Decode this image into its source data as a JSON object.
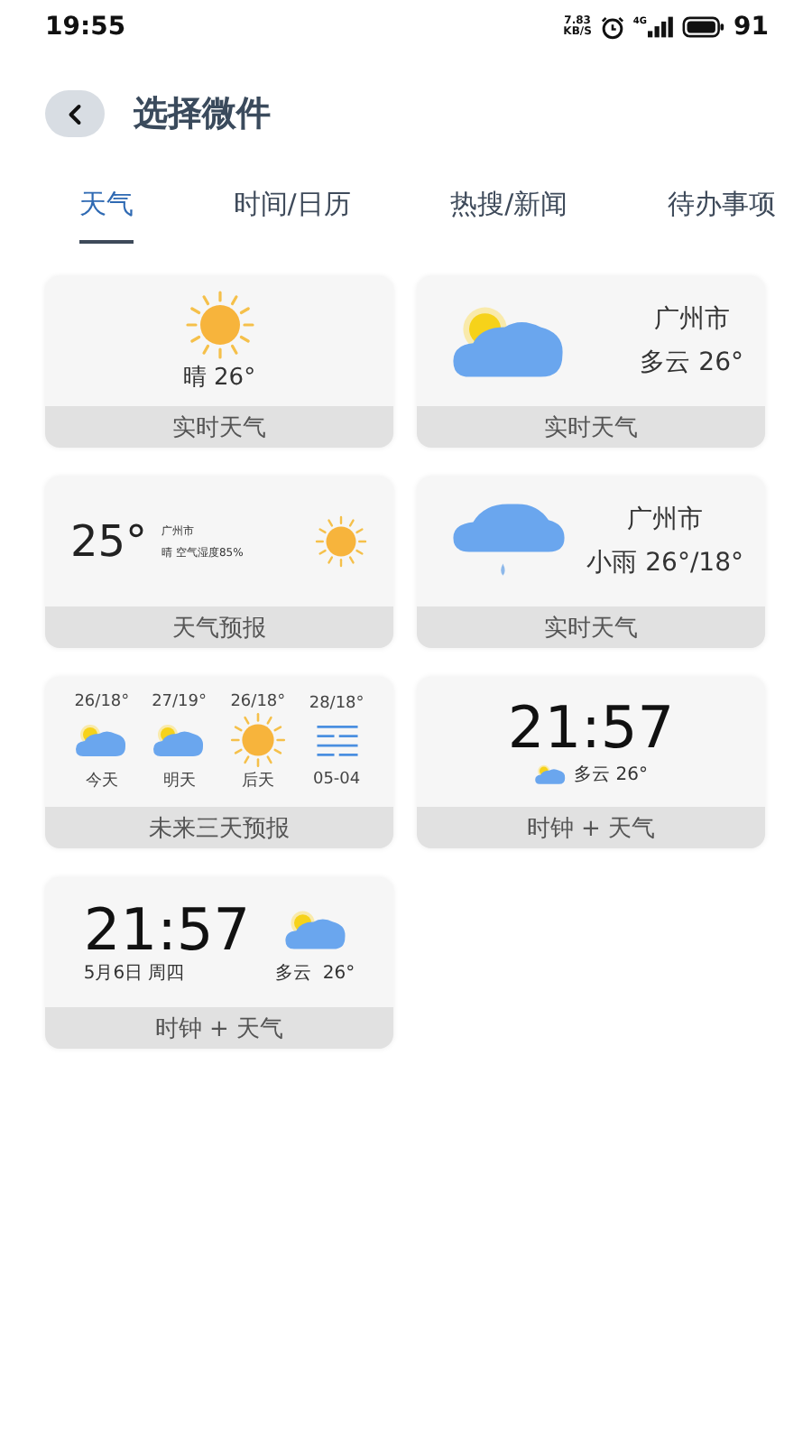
{
  "status_bar": {
    "time": "19:55",
    "speed_value": "7.83",
    "speed_unit": "KB/S",
    "network": "4G",
    "battery": "91"
  },
  "header": {
    "title": "选择微件"
  },
  "tabs": [
    {
      "label": "天气",
      "selected": true
    },
    {
      "label": "时间/日历",
      "selected": false
    },
    {
      "label": "热搜/新闻",
      "selected": false
    },
    {
      "label": "待办事项",
      "selected": false
    }
  ],
  "widgets": [
    {
      "kind": "sunny_center",
      "condition": "晴 26°",
      "label": "实时天气"
    },
    {
      "kind": "cloudy_city",
      "city": "广州市",
      "condition": "多云 26°",
      "label": "实时天气"
    },
    {
      "kind": "sunny_inline",
      "temp": "25°",
      "city": "广州市",
      "condition": "晴 空气湿度85%",
      "label": "天气预报"
    },
    {
      "kind": "rainy_city",
      "city": "广州市",
      "condition": "小雨 26°/18°",
      "label": "实时天气"
    },
    {
      "kind": "days",
      "label": "未来三天预报",
      "days": [
        {
          "kind": "cloudy",
          "temp": "26/18°",
          "name": "今天"
        },
        {
          "kind": "cloudy",
          "temp": "27/19°",
          "name": "明天"
        },
        {
          "kind": "sunny",
          "temp": "26/18°",
          "name": "后天"
        },
        {
          "kind": "foggy",
          "temp": "28/18°",
          "name": "05-04"
        }
      ]
    },
    {
      "kind": "clock",
      "time": "21:57",
      "condition": "多云 26°",
      "label": "时钟 + 天气"
    },
    {
      "kind": "clock_wide",
      "time": "21:57",
      "date": "5月6日 周四",
      "condition": "多云  26°",
      "label": "时钟 + 天气"
    }
  ]
}
